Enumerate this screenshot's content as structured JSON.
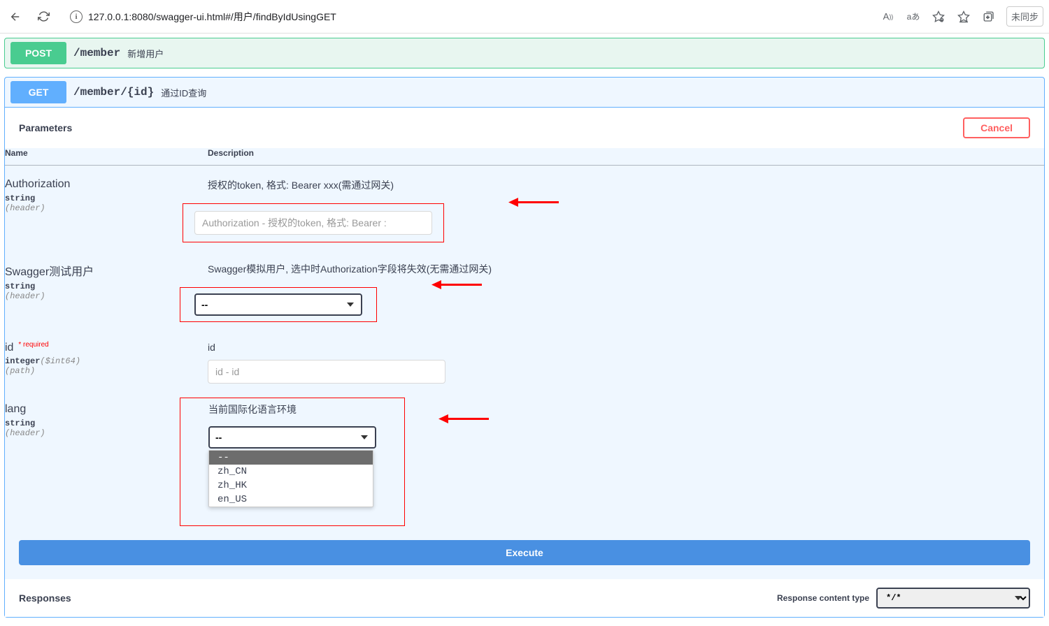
{
  "browser": {
    "url": "127.0.0.1:8080/swagger-ui.html#/用户/findByIdUsingGET",
    "translate_icon": "Aあ",
    "aa_icon": "Aあ",
    "sync_label": "未同步"
  },
  "endpoints": {
    "post": {
      "method": "POST",
      "path": "/member",
      "summary": "新增用户"
    },
    "get": {
      "method": "GET",
      "path": "/member/{id}",
      "summary": "通过ID查询"
    }
  },
  "parameters_section": {
    "title": "Parameters",
    "cancel_label": "Cancel",
    "headers": {
      "name": "Name",
      "description": "Description"
    }
  },
  "params": [
    {
      "name": "Authorization",
      "type": "string",
      "in": "(header)",
      "desc": "授权的token, 格式: Bearer xxx(需通过网关)",
      "placeholder": "Authorization - 授权的token, 格式: Bearer :"
    },
    {
      "name": "Swagger测试用户",
      "type": "string",
      "in": "(header)",
      "desc": "Swagger模拟用户, 选中时Authorization字段将失效(无需通过网关)",
      "select_value": "--"
    },
    {
      "name": "id",
      "required_label": "* required",
      "type": "integer",
      "format": "($int64)",
      "in": "(path)",
      "desc": "id",
      "placeholder": "id - id"
    },
    {
      "name": "lang",
      "type": "string",
      "in": "(header)",
      "desc": "当前国际化语言环境",
      "select_value": "--",
      "options": [
        "--",
        "zh_CN",
        "zh_HK",
        "en_US"
      ]
    }
  ],
  "execute_label": "Execute",
  "responses": {
    "title": "Responses",
    "content_type_label": "Response content type",
    "content_type_value": "*/*"
  }
}
